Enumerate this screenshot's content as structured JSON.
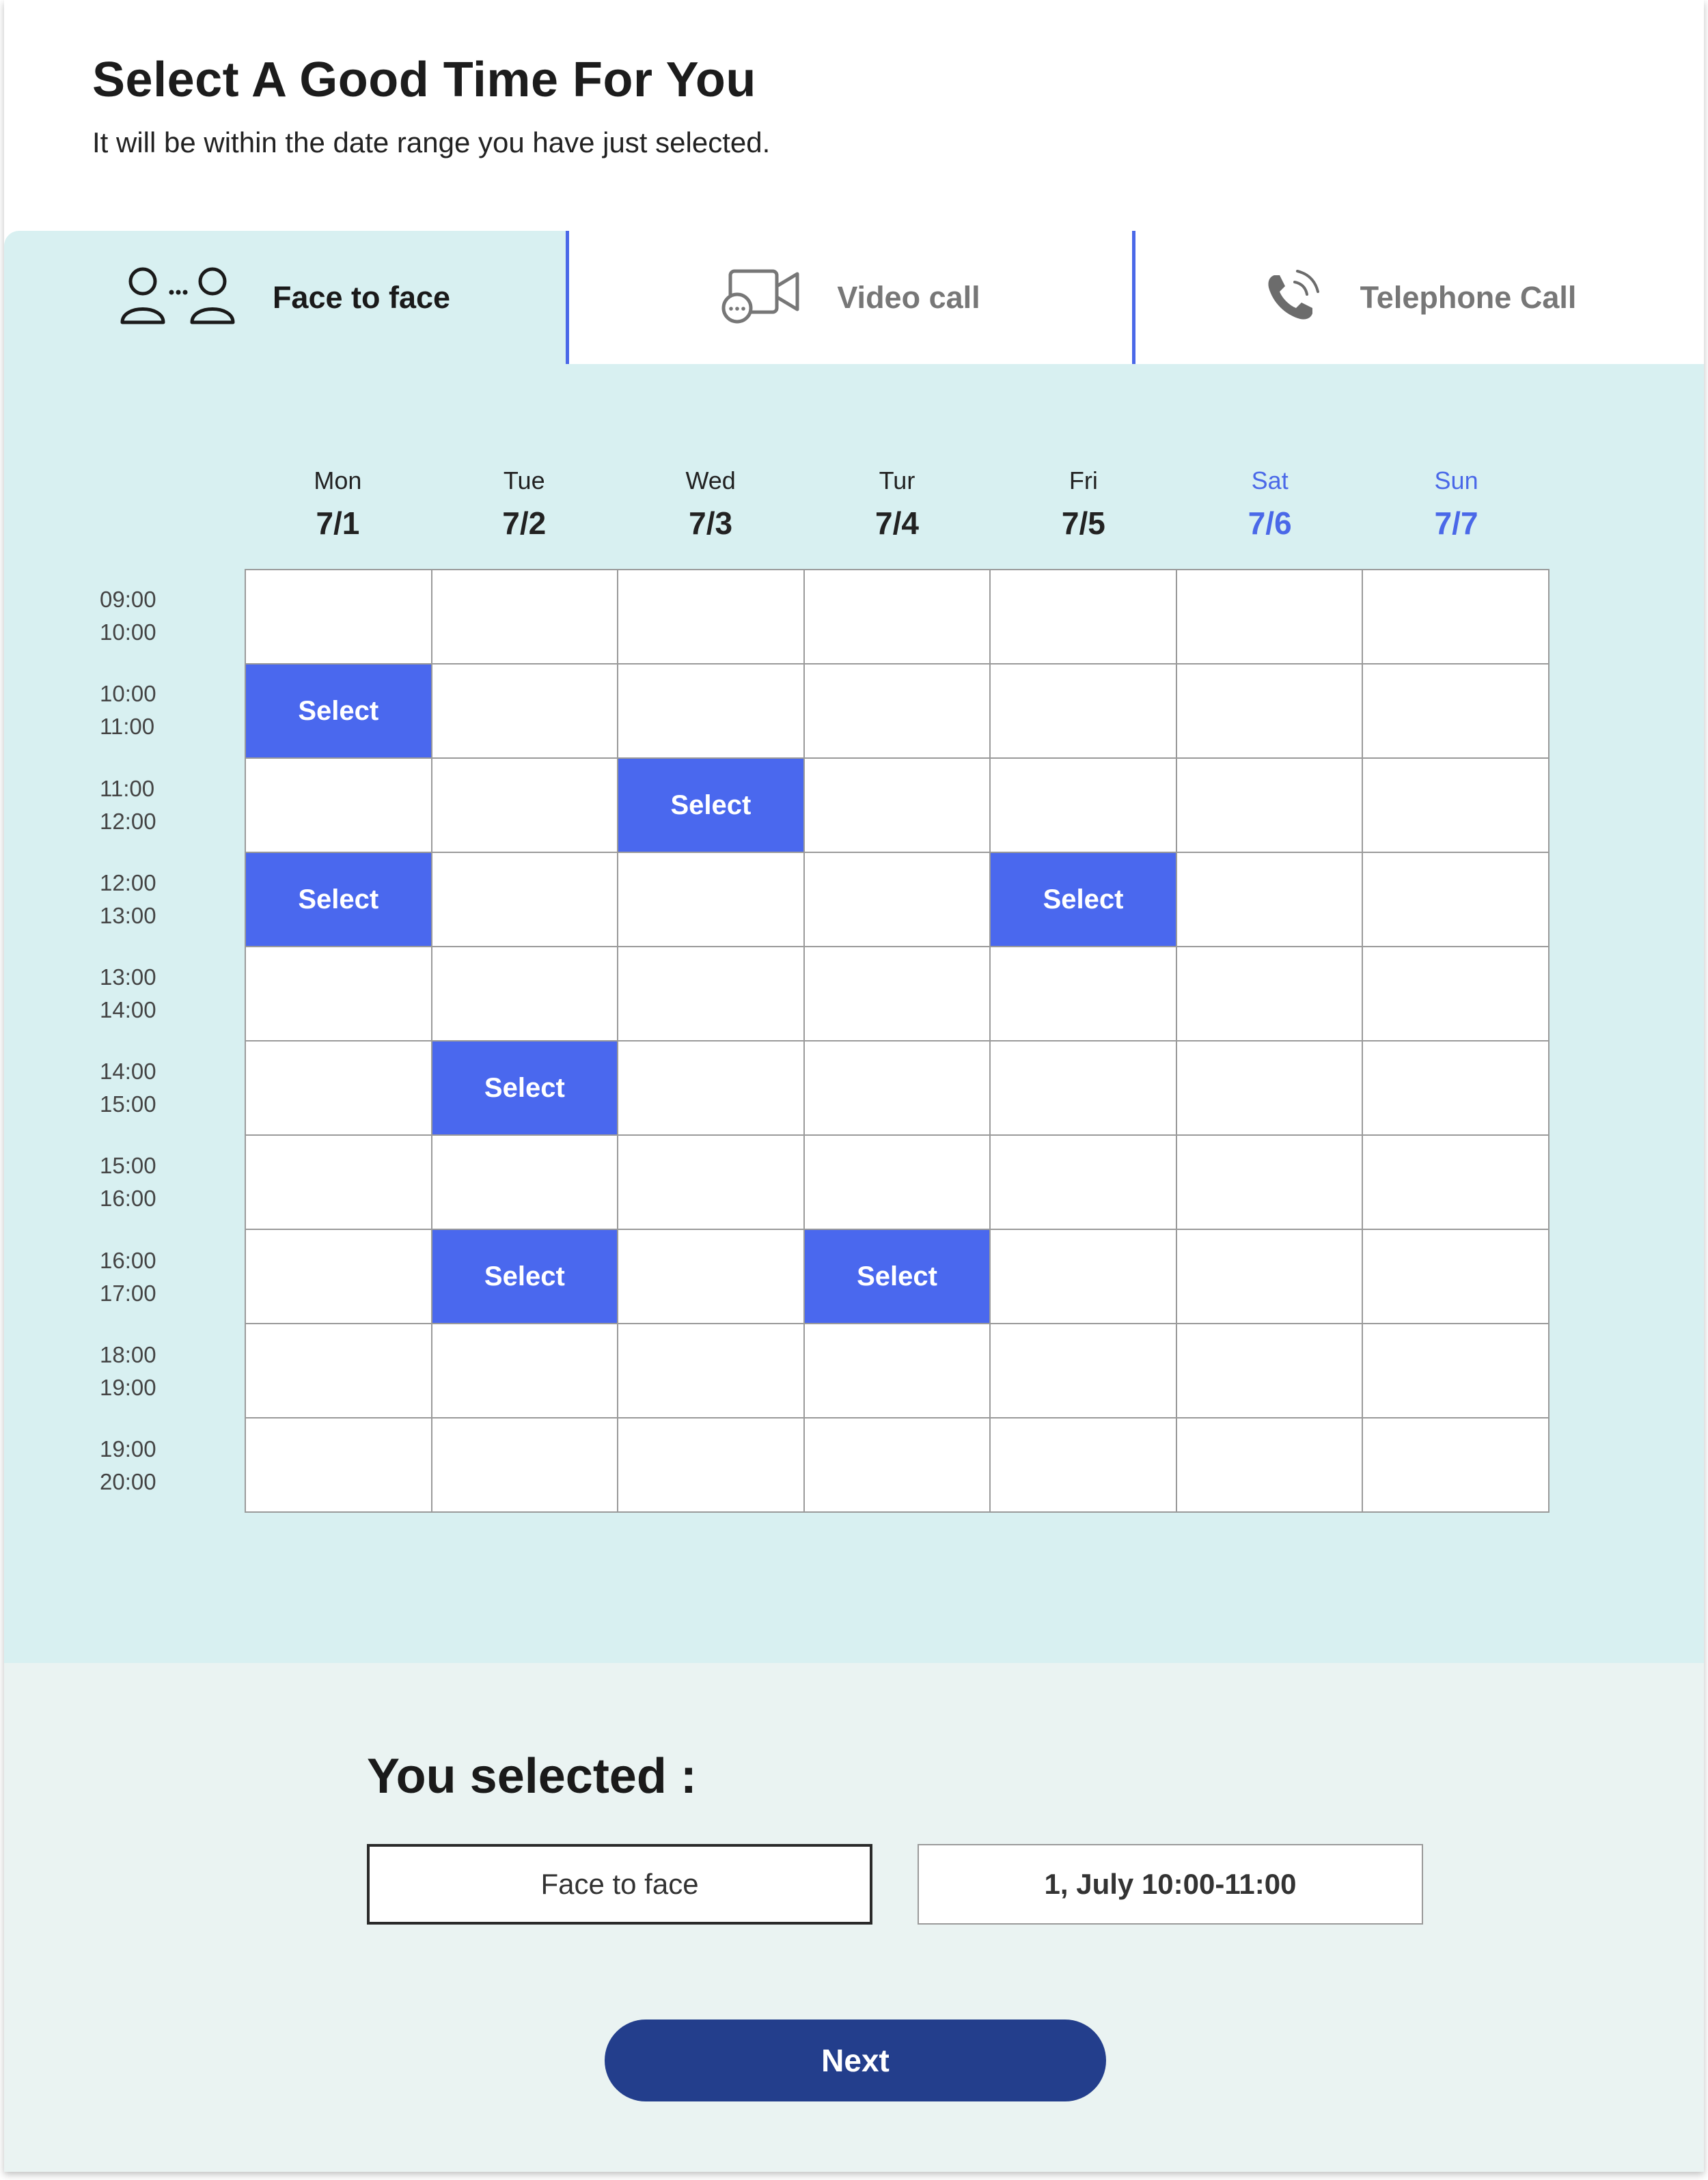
{
  "header": {
    "title": "Select A Good Time For You",
    "subtitle": "It will be within the date range you have just selected."
  },
  "tabs": [
    {
      "label": "Face to face",
      "icon": "people-icon",
      "active": true
    },
    {
      "label": "Video call",
      "icon": "video-camera-icon",
      "active": false
    },
    {
      "label": "Telephone Call",
      "icon": "phone-icon",
      "active": false
    }
  ],
  "calendar": {
    "days": [
      {
        "name": "Mon",
        "date": "7/1",
        "weekend": false
      },
      {
        "name": "Tue",
        "date": "7/2",
        "weekend": false
      },
      {
        "name": "Wed",
        "date": "7/3",
        "weekend": false
      },
      {
        "name": "Tur",
        "date": "7/4",
        "weekend": false
      },
      {
        "name": "Fri",
        "date": "7/5",
        "weekend": false
      },
      {
        "name": "Sat",
        "date": "7/6",
        "weekend": true
      },
      {
        "name": "Sun",
        "date": "7/7",
        "weekend": true
      }
    ],
    "time_slots": [
      {
        "start": "09:00",
        "end": "10:00"
      },
      {
        "start": "10:00",
        "end": "11:00"
      },
      {
        "start": "11:00",
        "end": "12:00"
      },
      {
        "start": "12:00",
        "end": "13:00"
      },
      {
        "start": "13:00",
        "end": "14:00"
      },
      {
        "start": "14:00",
        "end": "15:00"
      },
      {
        "start": "15:00",
        "end": "16:00"
      },
      {
        "start": "16:00",
        "end": "17:00"
      },
      {
        "start": "18:00",
        "end": "19:00"
      },
      {
        "start": "19:00",
        "end": "20:00"
      }
    ],
    "select_label": "Select",
    "available_slots": [
      {
        "slot": 1,
        "day": 0
      },
      {
        "slot": 2,
        "day": 2
      },
      {
        "slot": 3,
        "day": 0
      },
      {
        "slot": 3,
        "day": 4
      },
      {
        "slot": 5,
        "day": 1
      },
      {
        "slot": 7,
        "day": 1
      },
      {
        "slot": 7,
        "day": 3
      }
    ]
  },
  "summary": {
    "heading": "You selected :",
    "method": "Face to face",
    "slot": "1, July 10:00-11:00"
  },
  "next_button": {
    "label": "Next"
  },
  "colors": {
    "accent": "#4a68ee",
    "panel_bg": "#d8f0f1",
    "bottom_bg": "#eaf3f2",
    "button_bg": "#233e8c"
  }
}
